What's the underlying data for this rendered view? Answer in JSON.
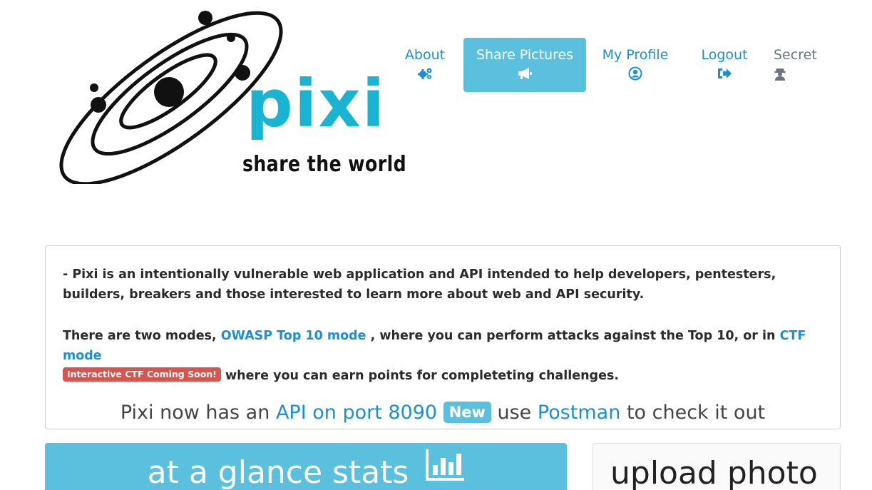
{
  "logo": {
    "word": "pixi",
    "tagline": "share the world",
    "colors": {
      "word": "#1ab4d2",
      "orbit": "#111111"
    }
  },
  "nav": {
    "about": {
      "label": "About",
      "icon": "gears-icon"
    },
    "share": {
      "label": "Share Pictures",
      "icon": "bullhorn-icon",
      "active": true
    },
    "profile": {
      "label": "My Profile",
      "icon": "user-circle-icon"
    },
    "logout": {
      "label": "Logout",
      "icon": "sign-out-icon"
    },
    "secret": {
      "label": "Secret",
      "icon": "user-secret-icon"
    }
  },
  "intro": {
    "p1": "- Pixi is an intentionally vulnerable web application and API intended to help developers, pentesters, builders, breakers and those interested to learn more about web and API security.",
    "p2_a": "There are two modes,",
    "p2_link_owasp": "OWASP Top 10 mode",
    "p2_b": ", where you can perform attacks against the Top 10, or in",
    "p2_link_ctf": "CTF mode",
    "p2_badge": "Interactive CTF Coming Soon!",
    "p2_c": "where you can earn points for completeting challenges.",
    "api_a": "Pixi now has an",
    "api_link": "API on port 8090",
    "api_badge": "New",
    "api_b": "use",
    "api_link_postman": "Postman",
    "api_c": "to check it out"
  },
  "stats": {
    "title": "at a glance stats",
    "icon": "bar-chart-icon"
  },
  "upload": {
    "title": "upload photo"
  },
  "colors": {
    "accent": "#5bc0de",
    "link": "#1a8fd6",
    "badge_red": "#d9534f"
  }
}
